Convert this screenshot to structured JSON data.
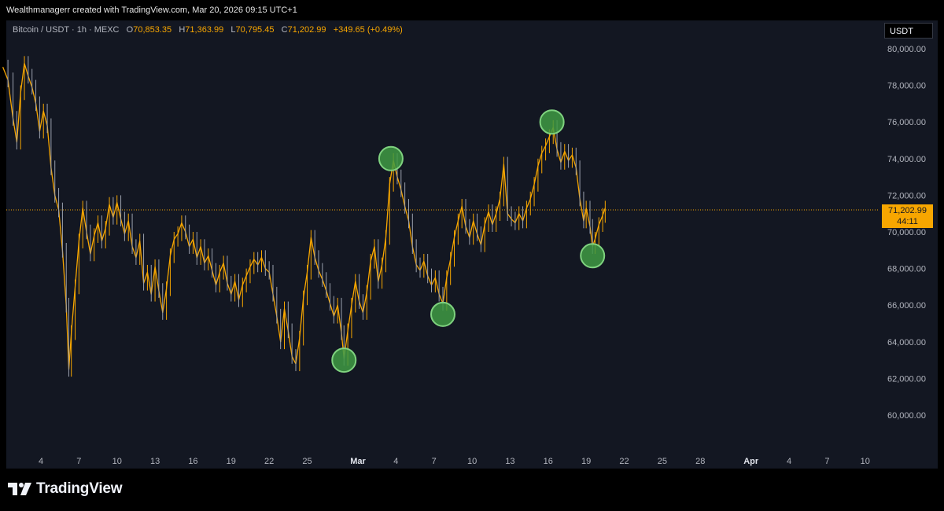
{
  "header": {
    "text": "Wealthmanagerr created with TradingView.com, Mar 20, 2026 09:15 UTC+1"
  },
  "legend": {
    "symbol": "Bitcoin / USDT · 1h · MEXC",
    "o_label": "O",
    "o_value": "70,853.35",
    "h_label": "H",
    "h_value": "71,363.99",
    "l_label": "L",
    "l_value": "70,795.45",
    "c_label": "C",
    "c_value": "71,202.99",
    "change": "+349.65 (+0.49%)"
  },
  "currency": "USDT",
  "price_tag": {
    "price": "71,202.99",
    "countdown": "44:11"
  },
  "logo": {
    "text": "TradingView"
  },
  "colors": {
    "background": "#131722",
    "price_line": "#f7a600",
    "marker": "#3f9a43",
    "marker_stroke": "#7fd27f",
    "axis_text": "#b2b5be"
  },
  "chart_data": {
    "type": "line",
    "title": "Bitcoin / USDT · 1h · MEXC",
    "ylim": [
      58000,
      81000
    ],
    "y_ticks": [
      {
        "value": 80000,
        "label": "80,000.00"
      },
      {
        "value": 78000,
        "label": "78,000.00"
      },
      {
        "value": 76000,
        "label": "76,000.00"
      },
      {
        "value": 74000,
        "label": "74,000.00"
      },
      {
        "value": 72000,
        "label": "72,000.00"
      },
      {
        "value": 70000,
        "label": "70,000.00"
      },
      {
        "value": 68000,
        "label": "68,000.00"
      },
      {
        "value": 66000,
        "label": "66,000.00"
      },
      {
        "value": 64000,
        "label": "64,000.00"
      },
      {
        "value": 62000,
        "label": "62,000.00"
      },
      {
        "value": 60000,
        "label": "60,000.00"
      }
    ],
    "x_ticks": [
      {
        "day": 4,
        "label": "4",
        "bold": false
      },
      {
        "day": 7,
        "label": "7",
        "bold": false
      },
      {
        "day": 10,
        "label": "10",
        "bold": false
      },
      {
        "day": 13,
        "label": "13",
        "bold": false
      },
      {
        "day": 16,
        "label": "16",
        "bold": false
      },
      {
        "day": 19,
        "label": "19",
        "bold": false
      },
      {
        "day": 22,
        "label": "22",
        "bold": false
      },
      {
        "day": 25,
        "label": "25",
        "bold": false
      },
      {
        "day": 29,
        "label": "Mar",
        "bold": true
      },
      {
        "day": 32,
        "label": "4",
        "bold": false
      },
      {
        "day": 35,
        "label": "7",
        "bold": false
      },
      {
        "day": 38,
        "label": "10",
        "bold": false
      },
      {
        "day": 41,
        "label": "13",
        "bold": false
      },
      {
        "day": 44,
        "label": "16",
        "bold": false
      },
      {
        "day": 47,
        "label": "19",
        "bold": false
      },
      {
        "day": 50,
        "label": "22",
        "bold": false
      },
      {
        "day": 53,
        "label": "25",
        "bold": false
      },
      {
        "day": 56,
        "label": "28",
        "bold": false
      },
      {
        "day": 60,
        "label": "Apr",
        "bold": true
      },
      {
        "day": 63,
        "label": "4",
        "bold": false
      },
      {
        "day": 66,
        "label": "7",
        "bold": false
      },
      {
        "day": 69,
        "label": "10",
        "bold": false
      }
    ],
    "x_unit_note": "day index: 1 = Feb 1, 29 = Mar 1",
    "series": [
      {
        "values": [
          [
            1.0,
            79000
          ],
          [
            1.4,
            78300
          ],
          [
            1.8,
            76200
          ],
          [
            2.1,
            74900
          ],
          [
            2.4,
            77600
          ],
          [
            2.7,
            79200
          ],
          [
            3.0,
            78500
          ],
          [
            3.3,
            77900
          ],
          [
            3.6,
            77000
          ],
          [
            3.9,
            75500
          ],
          [
            4.2,
            76600
          ],
          [
            4.5,
            75800
          ],
          [
            4.8,
            73500
          ],
          [
            5.1,
            72000
          ],
          [
            5.4,
            71200
          ],
          [
            5.7,
            69000
          ],
          [
            6.0,
            66000
          ],
          [
            6.2,
            62500
          ],
          [
            6.4,
            64500
          ],
          [
            6.7,
            67000
          ],
          [
            7.0,
            69500
          ],
          [
            7.3,
            71300
          ],
          [
            7.6,
            70000
          ],
          [
            7.9,
            68800
          ],
          [
            8.2,
            69800
          ],
          [
            8.5,
            70500
          ],
          [
            8.8,
            69500
          ],
          [
            9.1,
            70200
          ],
          [
            9.4,
            71500
          ],
          [
            9.7,
            70800
          ],
          [
            10.0,
            71600
          ],
          [
            10.3,
            70700
          ],
          [
            10.6,
            69900
          ],
          [
            10.9,
            70600
          ],
          [
            11.2,
            69200
          ],
          [
            11.5,
            68600
          ],
          [
            11.8,
            69500
          ],
          [
            12.1,
            67200
          ],
          [
            12.4,
            67800
          ],
          [
            12.7,
            66600
          ],
          [
            13.0,
            68100
          ],
          [
            13.3,
            66800
          ],
          [
            13.6,
            65600
          ],
          [
            13.9,
            66900
          ],
          [
            14.2,
            68700
          ],
          [
            14.5,
            69600
          ],
          [
            14.8,
            69900
          ],
          [
            15.1,
            70500
          ],
          [
            15.4,
            70000
          ],
          [
            15.7,
            69200
          ],
          [
            16.0,
            69600
          ],
          [
            16.3,
            68600
          ],
          [
            16.6,
            69200
          ],
          [
            16.9,
            68300
          ],
          [
            17.2,
            68700
          ],
          [
            17.5,
            67900
          ],
          [
            17.8,
            67100
          ],
          [
            18.1,
            67800
          ],
          [
            18.4,
            68300
          ],
          [
            18.7,
            67200
          ],
          [
            19.0,
            66600
          ],
          [
            19.3,
            67300
          ],
          [
            19.6,
            66300
          ],
          [
            19.9,
            67100
          ],
          [
            20.2,
            67600
          ],
          [
            20.5,
            68100
          ],
          [
            20.8,
            68500
          ],
          [
            21.1,
            68200
          ],
          [
            21.4,
            68600
          ],
          [
            21.7,
            68000
          ],
          [
            22.0,
            67800
          ],
          [
            22.3,
            66600
          ],
          [
            22.6,
            65400
          ],
          [
            22.9,
            64000
          ],
          [
            23.2,
            65800
          ],
          [
            23.5,
            64600
          ],
          [
            23.8,
            63200
          ],
          [
            24.1,
            62800
          ],
          [
            24.4,
            64200
          ],
          [
            24.7,
            66400
          ],
          [
            25.0,
            67800
          ],
          [
            25.3,
            69700
          ],
          [
            25.6,
            68600
          ],
          [
            25.9,
            67900
          ],
          [
            26.2,
            67400
          ],
          [
            26.5,
            66800
          ],
          [
            26.8,
            66100
          ],
          [
            27.1,
            65400
          ],
          [
            27.4,
            66000
          ],
          [
            27.7,
            64500
          ],
          [
            27.9,
            63100
          ],
          [
            28.2,
            64600
          ],
          [
            28.5,
            66000
          ],
          [
            28.8,
            67300
          ],
          [
            29.1,
            66200
          ],
          [
            29.4,
            65600
          ],
          [
            29.7,
            66700
          ],
          [
            30.0,
            68400
          ],
          [
            30.3,
            69200
          ],
          [
            30.6,
            67300
          ],
          [
            30.9,
            68200
          ],
          [
            31.2,
            69700
          ],
          [
            31.5,
            72600
          ],
          [
            31.8,
            73900
          ],
          [
            32.1,
            73000
          ],
          [
            32.4,
            72300
          ],
          [
            32.7,
            71400
          ],
          [
            33.0,
            70600
          ],
          [
            33.3,
            69200
          ],
          [
            33.6,
            68200
          ],
          [
            33.9,
            67900
          ],
          [
            34.2,
            68400
          ],
          [
            34.5,
            67600
          ],
          [
            34.8,
            67100
          ],
          [
            35.1,
            67500
          ],
          [
            35.4,
            66600
          ],
          [
            35.7,
            66100
          ],
          [
            36.0,
            67500
          ],
          [
            36.3,
            68500
          ],
          [
            36.6,
            69700
          ],
          [
            36.9,
            70600
          ],
          [
            37.2,
            71400
          ],
          [
            37.5,
            70300
          ],
          [
            37.8,
            69700
          ],
          [
            38.1,
            70600
          ],
          [
            38.4,
            69900
          ],
          [
            38.7,
            69300
          ],
          [
            39.0,
            70400
          ],
          [
            39.3,
            71100
          ],
          [
            39.6,
            70400
          ],
          [
            39.9,
            71000
          ],
          [
            40.2,
            71800
          ],
          [
            40.5,
            73700
          ],
          [
            40.8,
            71000
          ],
          [
            41.1,
            70700
          ],
          [
            41.4,
            70500
          ],
          [
            41.7,
            71000
          ],
          [
            42.0,
            70600
          ],
          [
            42.3,
            71300
          ],
          [
            42.6,
            71800
          ],
          [
            42.9,
            72600
          ],
          [
            43.2,
            73600
          ],
          [
            43.5,
            74300
          ],
          [
            43.8,
            74700
          ],
          [
            44.1,
            75200
          ],
          [
            44.4,
            75700
          ],
          [
            44.7,
            74500
          ],
          [
            45.0,
            73800
          ],
          [
            45.3,
            74400
          ],
          [
            45.6,
            73900
          ],
          [
            45.9,
            74200
          ],
          [
            46.2,
            73500
          ],
          [
            46.5,
            71800
          ],
          [
            46.8,
            70600
          ],
          [
            47.0,
            71300
          ],
          [
            47.3,
            70300
          ],
          [
            47.5,
            69200
          ],
          [
            47.7,
            69600
          ],
          [
            48.0,
            70400
          ],
          [
            48.3,
            70900
          ],
          [
            48.5,
            71300
          ]
        ]
      }
    ],
    "last_price": 71202.99,
    "annotations": [
      {
        "type": "circle",
        "x": 27.9,
        "y": 63000
      },
      {
        "type": "circle",
        "x": 31.6,
        "y": 74000
      },
      {
        "type": "circle",
        "x": 35.7,
        "y": 65500
      },
      {
        "type": "circle",
        "x": 44.3,
        "y": 76000
      },
      {
        "type": "circle",
        "x": 47.5,
        "y": 68700
      }
    ]
  }
}
